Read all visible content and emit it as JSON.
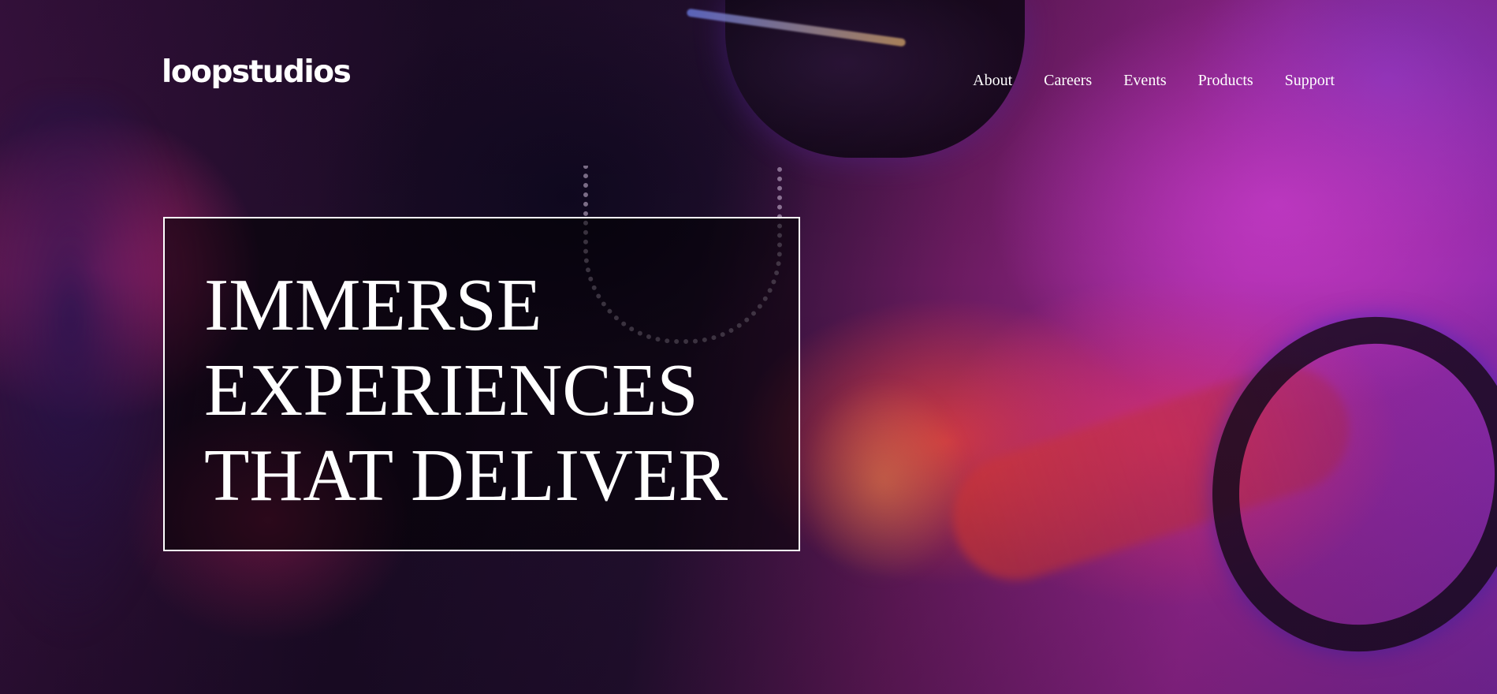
{
  "brand": {
    "logo_text": "loopstudios"
  },
  "nav": {
    "items": [
      {
        "label": "About"
      },
      {
        "label": "Careers"
      },
      {
        "label": "Events"
      },
      {
        "label": "Products"
      },
      {
        "label": "Support"
      }
    ]
  },
  "hero": {
    "headline_lines": [
      "IMMERSE",
      "EXPERIENCES",
      "THAT DELIVER"
    ],
    "background_image": "vr-headset-racing-wheel-photo"
  },
  "colors": {
    "text": "#ffffff",
    "box_border": "#ffffff",
    "box_background": "rgba(0,0,0,0.55)",
    "accent_magenta": "#c43ac8",
    "accent_red": "#ee3478"
  }
}
